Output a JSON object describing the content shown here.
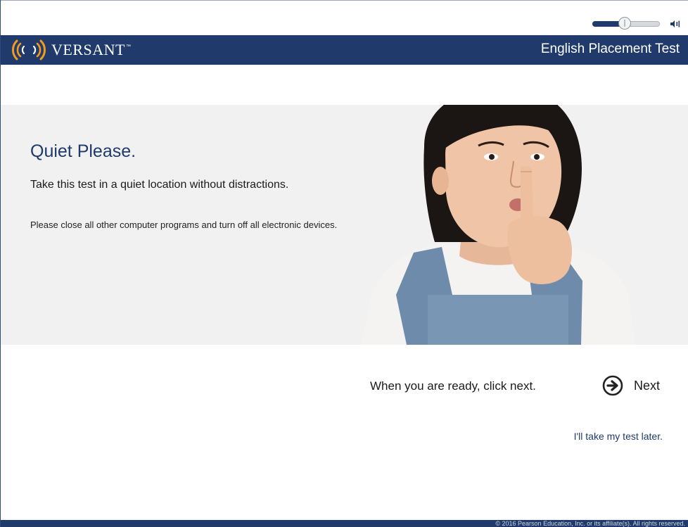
{
  "volume": {
    "level": 0.45
  },
  "header": {
    "brand": "VERSANT",
    "brand_mark": "™",
    "title": "English Placement Test"
  },
  "hero": {
    "title": "Quiet Please.",
    "subtitle": "Take this test in a quiet location without distractions.",
    "note": "Please close all other computer programs and turn off all electronic devices."
  },
  "actions": {
    "ready_text": "When you are ready, click next.",
    "next_label": "Next",
    "later_link": "I'll take my test later."
  },
  "footer": {
    "copyright": "© 2016 Pearson Education, Inc. or its affiliate(s). All rights reserved."
  },
  "colors": {
    "brand_navy": "#1f3a6b",
    "logo_orange": "#f29a1f",
    "hero_bg": "#f1f1f1"
  },
  "icons": {
    "next": "arrow-circle-right-icon",
    "volume": "speaker-icon",
    "logo": "sound-waves-icon"
  }
}
